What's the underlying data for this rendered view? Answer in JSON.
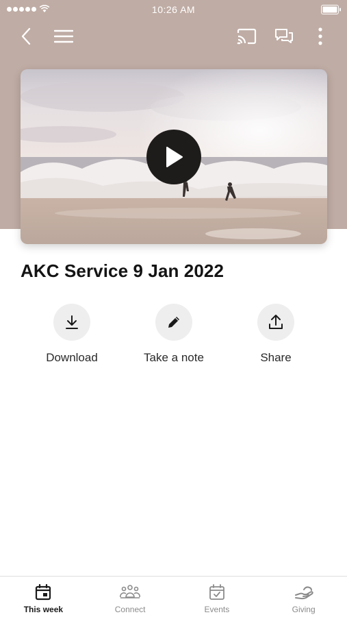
{
  "status_bar": {
    "time": "10:26 AM"
  },
  "nav": {
    "back_icon": "chevron-left-icon",
    "menu_icon": "hamburger-menu-icon",
    "cast_icon": "cast-icon",
    "chat_icon": "chat-bubbles-icon",
    "more_icon": "more-vertical-icon"
  },
  "video": {
    "play_icon": "play-icon",
    "thumbnail": "ocean-waves-surfers"
  },
  "sermon": {
    "title": "AKC Service 9 Jan 2022"
  },
  "actions": [
    {
      "label": "Download",
      "icon": "download-icon"
    },
    {
      "label": "Take a note",
      "icon": "pencil-icon"
    },
    {
      "label": "Share",
      "icon": "share-icon"
    }
  ],
  "tabs": [
    {
      "label": "This week",
      "icon": "calendar-icon",
      "active": true
    },
    {
      "label": "Connect",
      "icon": "people-icon",
      "active": false
    },
    {
      "label": "Events",
      "icon": "calendar-check-icon",
      "active": false
    },
    {
      "label": "Giving",
      "icon": "giving-hand-icon",
      "active": false
    }
  ],
  "colors": {
    "hero": "#bfaca4",
    "accent": "#1e1c1b",
    "action_bg": "#efeeee"
  }
}
